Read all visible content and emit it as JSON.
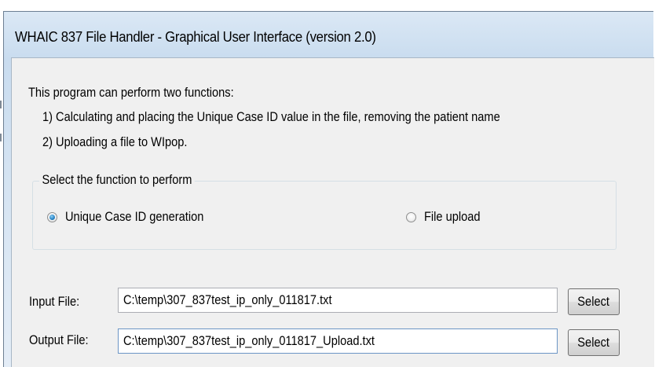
{
  "window": {
    "title": "WHAIC 837 File Handler - Graphical User Interface  (version 2.0)"
  },
  "description": {
    "line1": "This program can perform two functions:",
    "line2": "1) Calculating and placing the Unique Case ID value in the file, removing the patient name",
    "line3": "2) Uploading a file to WIpop."
  },
  "function_group": {
    "legend": "Select the function to perform",
    "options": [
      {
        "label": "Unique Case ID generation",
        "selected": true
      },
      {
        "label": "File upload",
        "selected": false
      }
    ]
  },
  "input_file": {
    "label": "Input File:",
    "value": "C:\\temp\\307_837test_ip_only_011817.txt",
    "button_label": "Select"
  },
  "output_file": {
    "label": "Output File:",
    "value": "C:\\temp\\307_837test_ip_only_011817_Upload.txt",
    "button_label": "Select"
  },
  "colors": {
    "title_bar_gradient_top": "#dbe8f5",
    "client_background": "#f0f0f0",
    "radio_selected": "#2a86c8",
    "focused_textbox_border": "#6b95c5"
  }
}
